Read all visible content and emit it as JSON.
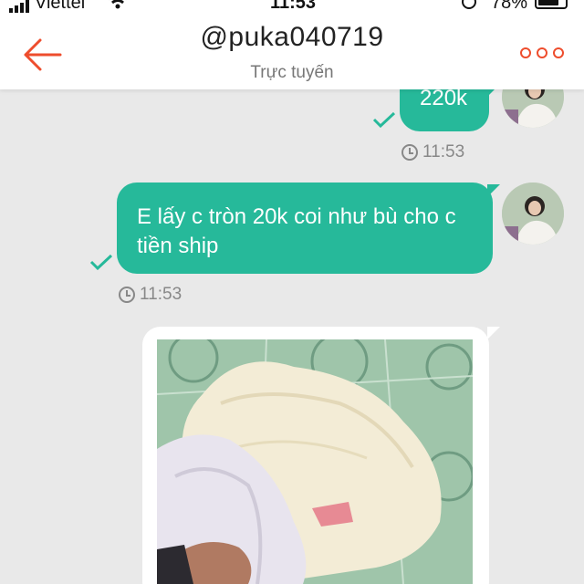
{
  "status_bar": {
    "carrier": "Viettel",
    "time": "11:53",
    "battery_percent": "78%",
    "battery_level": 0.78
  },
  "header": {
    "title": "@puka040719",
    "subtitle": "Trực tuyến"
  },
  "messages": [
    {
      "type": "text",
      "text": "220k",
      "time": "11:53",
      "status": "sent"
    },
    {
      "type": "text",
      "text": "E lấy c tròn 20k coi như bù cho c tiền ship",
      "time": "11:53",
      "status": "sent"
    },
    {
      "type": "image",
      "subject": "bundle of white and lavender clothes on green tiled floor"
    }
  ],
  "colors": {
    "accent": "#ee4d2d",
    "bubble": "#26b99a",
    "background": "#e9e9e9"
  },
  "icons": [
    "back-arrow-icon",
    "more-options-icon",
    "read-check-icon",
    "clock-icon",
    "wifi-icon",
    "signal-icon",
    "battery-icon"
  ]
}
